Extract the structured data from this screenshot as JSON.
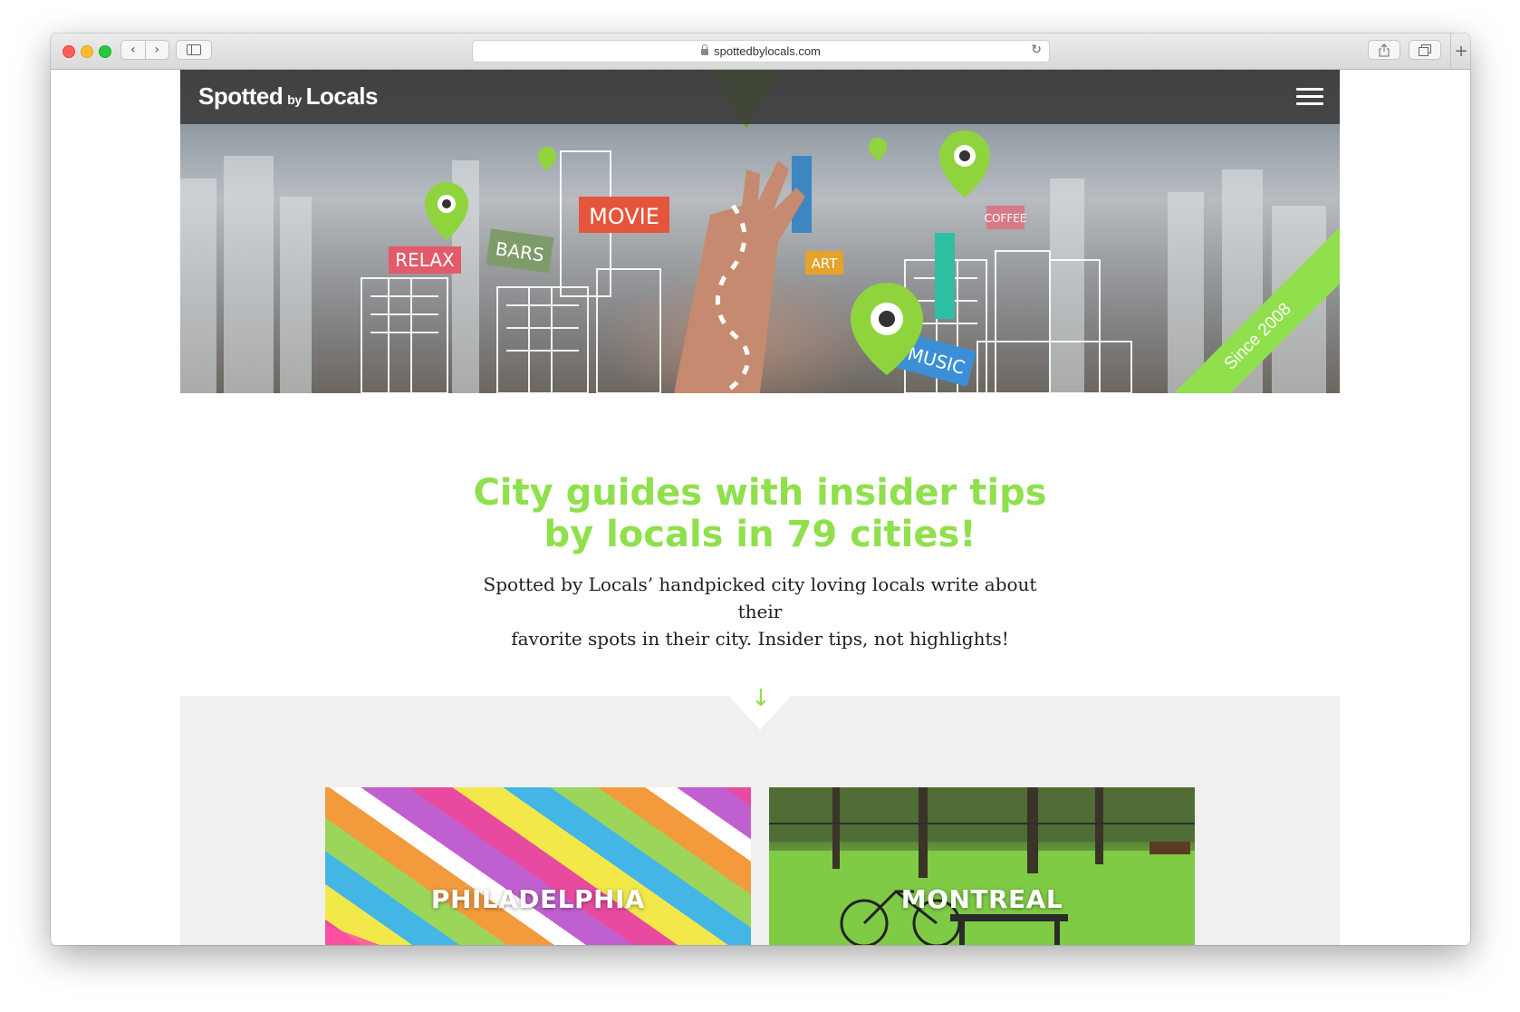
{
  "browser": {
    "url": "spottedbylocals.com",
    "nav_back": "‹",
    "nav_forward": "›",
    "new_tab": "+"
  },
  "header": {
    "logo_main_1": "Spotted",
    "logo_small": "by",
    "logo_main_2": "Locals"
  },
  "hero": {
    "ribbon_text": "Since 2008"
  },
  "intro": {
    "headline_line1": "City guides with insider tips",
    "headline_line2": "by locals in 79 cities!",
    "subtext_line1": "Spotted by Locals’ handpicked city loving locals write about their",
    "subtext_line2": "favorite spots in their city. Insider tips, not highlights!"
  },
  "scroll_arrow": "↓",
  "cities": [
    {
      "name": "PHILADELPHIA"
    },
    {
      "name": "MONTREAL"
    }
  ],
  "colors": {
    "accent_green": "#8fe04c",
    "header_bg": "#3a3a3a",
    "section_grey": "#f1f0ee"
  }
}
